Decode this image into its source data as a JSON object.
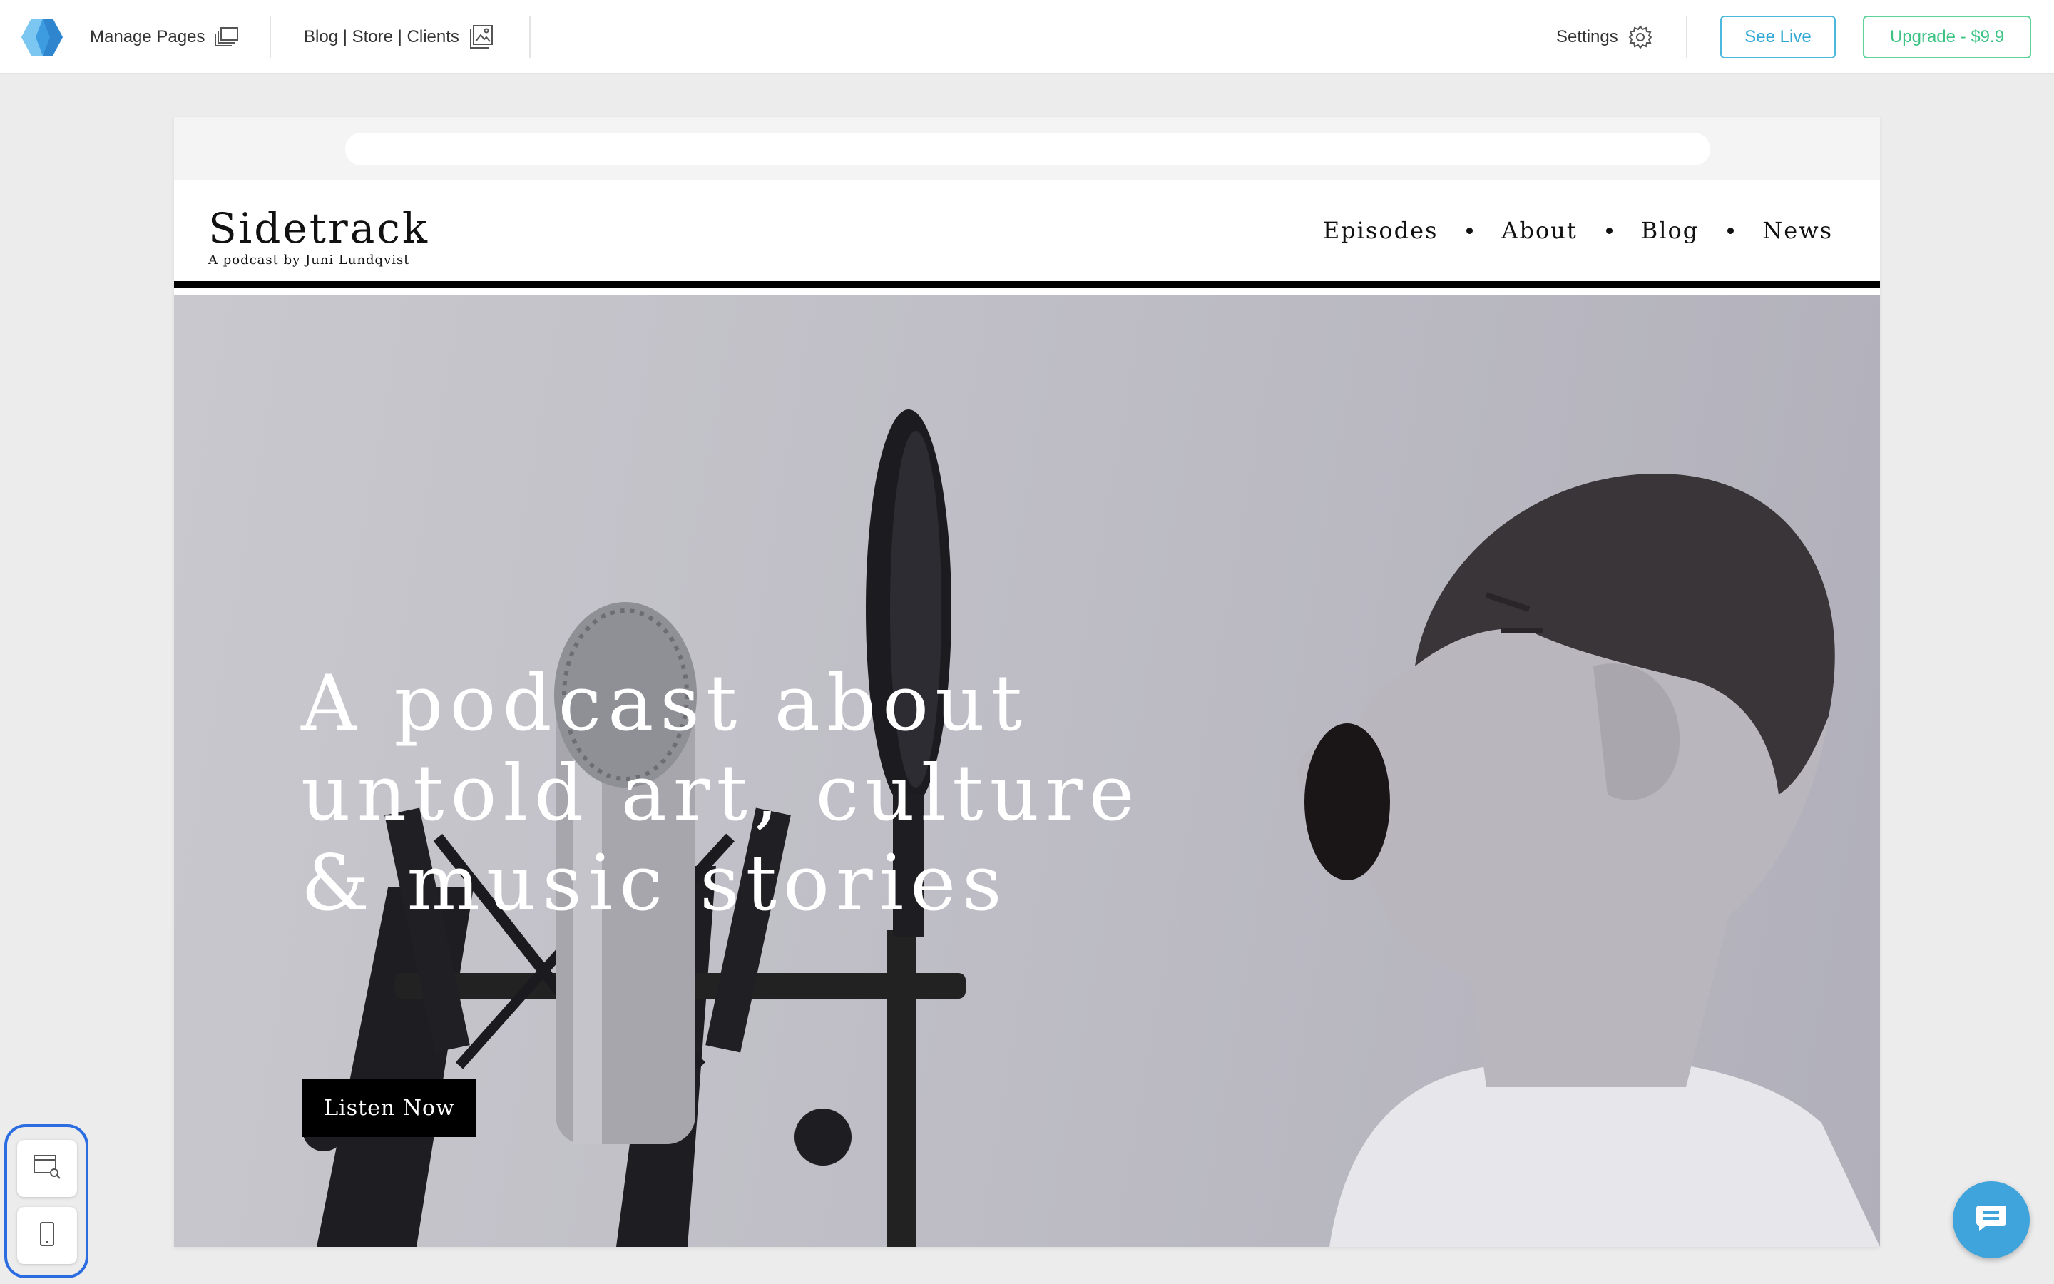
{
  "topbar": {
    "manage_pages": "Manage Pages",
    "blog_store_clients": "Blog | Store | Clients",
    "settings": "Settings",
    "see_live": "See Live",
    "upgrade": "Upgrade - $9.9"
  },
  "icons": {
    "logo": "app-logo-icon",
    "manage_pages": "pages-stack-icon",
    "blog_store_clients": "image-gallery-icon",
    "settings": "gear-icon",
    "desktop_view": "desktop-search-icon",
    "mobile_view": "mobile-phone-icon",
    "chat": "chat-bubble-icon"
  },
  "site": {
    "title": "Sidetrack",
    "subtitle": "A podcast by Juni Lundqvist",
    "nav": [
      "Episodes",
      "About",
      "Blog",
      "News"
    ]
  },
  "hero": {
    "line1": "A podcast about",
    "line2": "untold art, culture",
    "line3": "& music stories",
    "button": "Listen Now"
  },
  "colors": {
    "see_live": "#2fa8d6",
    "upgrade": "#3cc384",
    "view_toggle_outline": "#2b6de0",
    "chat": "#3ea4db",
    "header_rule": "#000000"
  }
}
